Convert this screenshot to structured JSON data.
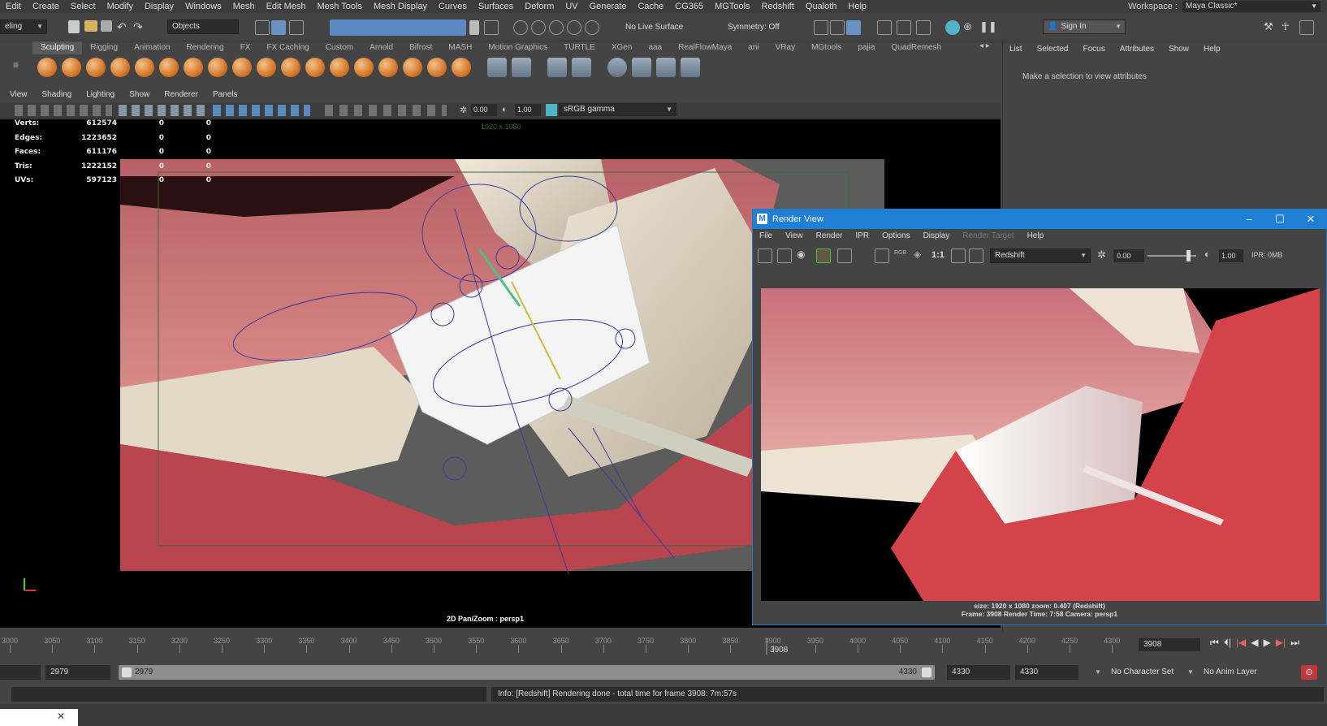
{
  "menubar": {
    "items": [
      "Edit",
      "Create",
      "Select",
      "Modify",
      "Display",
      "Windows",
      "Mesh",
      "Edit Mesh",
      "Mesh Tools",
      "Mesh Display",
      "Curves",
      "Surfaces",
      "Deform",
      "UV",
      "Generate",
      "Cache",
      "CG365",
      "MGTools",
      "Redshift",
      "Qualoth",
      "Help"
    ],
    "workspace_label": "Workspace :",
    "workspace_value": "Maya Classic*"
  },
  "statusline": {
    "mode": "eling",
    "selection_mode": "Objects",
    "live_surface": "No Live Surface",
    "symmetry": "Symmetry: Off",
    "sign_in": "Sign In"
  },
  "shelf": {
    "tabs": [
      "Sculpting",
      "Rigging",
      "Animation",
      "Rendering",
      "FX",
      "FX Caching",
      "Custom",
      "Arnold",
      "Bifrost",
      "MASH",
      "Motion Graphics",
      "TURTLE",
      "XGen",
      "aaa",
      "RealFlowMaya",
      "ani",
      "VRay",
      "MGtools",
      "pajia",
      "QuadRemesh"
    ],
    "active_tab": "Sculpting"
  },
  "attribute_editor": {
    "menu": [
      "List",
      "Selected",
      "Focus",
      "Attributes",
      "Show",
      "Help"
    ],
    "message": "Make a selection to view attributes"
  },
  "viewport": {
    "menu": [
      "View",
      "Shading",
      "Lighting",
      "Show",
      "Renderer",
      "Panels"
    ],
    "exposure": "0.00",
    "gamma": "1.00",
    "color_space": "sRGB gamma",
    "hud": [
      {
        "label": "Verts:",
        "v1": "612574",
        "v2": "0",
        "v3": "0"
      },
      {
        "label": "Edges:",
        "v1": "1223652",
        "v2": "0",
        "v3": "0"
      },
      {
        "label": "Faces:",
        "v1": "611176",
        "v2": "0",
        "v3": "0"
      },
      {
        "label": "Tris:",
        "v1": "1222152",
        "v2": "0",
        "v3": "0"
      },
      {
        "label": "UVs:",
        "v1": "597123",
        "v2": "0",
        "v3": "0"
      }
    ],
    "resolution_gate": "1920 x 1080",
    "caption": "2D Pan/Zoom : persp1"
  },
  "render_view": {
    "title": "Render View",
    "menu": [
      "File",
      "View",
      "Render",
      "IPR",
      "Options",
      "Display",
      "Render Target",
      "Help"
    ],
    "renderer": "Redshift",
    "ratio": "1:1",
    "exposure": "0.00",
    "gamma": "1.00",
    "ipr_mem": "IPR: 0MB",
    "info_line1": "size: 1920 x 1080 zoom: 0.407      (Redshift)",
    "info_line2": "Frame: 3908      Render Time: 7:58      Camera: persp1"
  },
  "timeline": {
    "ticks": [
      "3000",
      "3050",
      "3100",
      "3150",
      "3200",
      "3250",
      "3300",
      "3350",
      "3400",
      "3450",
      "3500",
      "3550",
      "3600",
      "3650",
      "3700",
      "3750",
      "3800",
      "3850",
      "3900",
      "3950",
      "4000",
      "4050",
      "4100",
      "4150",
      "4200",
      "4250",
      "4300"
    ],
    "current_marker": "3908",
    "current_frame": "3908"
  },
  "range": {
    "start": "2979",
    "bar_start": "2979",
    "bar_end": "4330",
    "end": "4330",
    "anim_end": "4330",
    "character_set": "No Character Set",
    "anim_layer": "No Anim Layer"
  },
  "command": {
    "output": "Info:  [Redshift] Rendering done - total time for frame 3908: 7m:57s"
  },
  "colors": {
    "accent": "#1f7fd4",
    "gum": "#c9404a",
    "tooth": "#e6dccd",
    "rig": "#3a3aa0"
  }
}
